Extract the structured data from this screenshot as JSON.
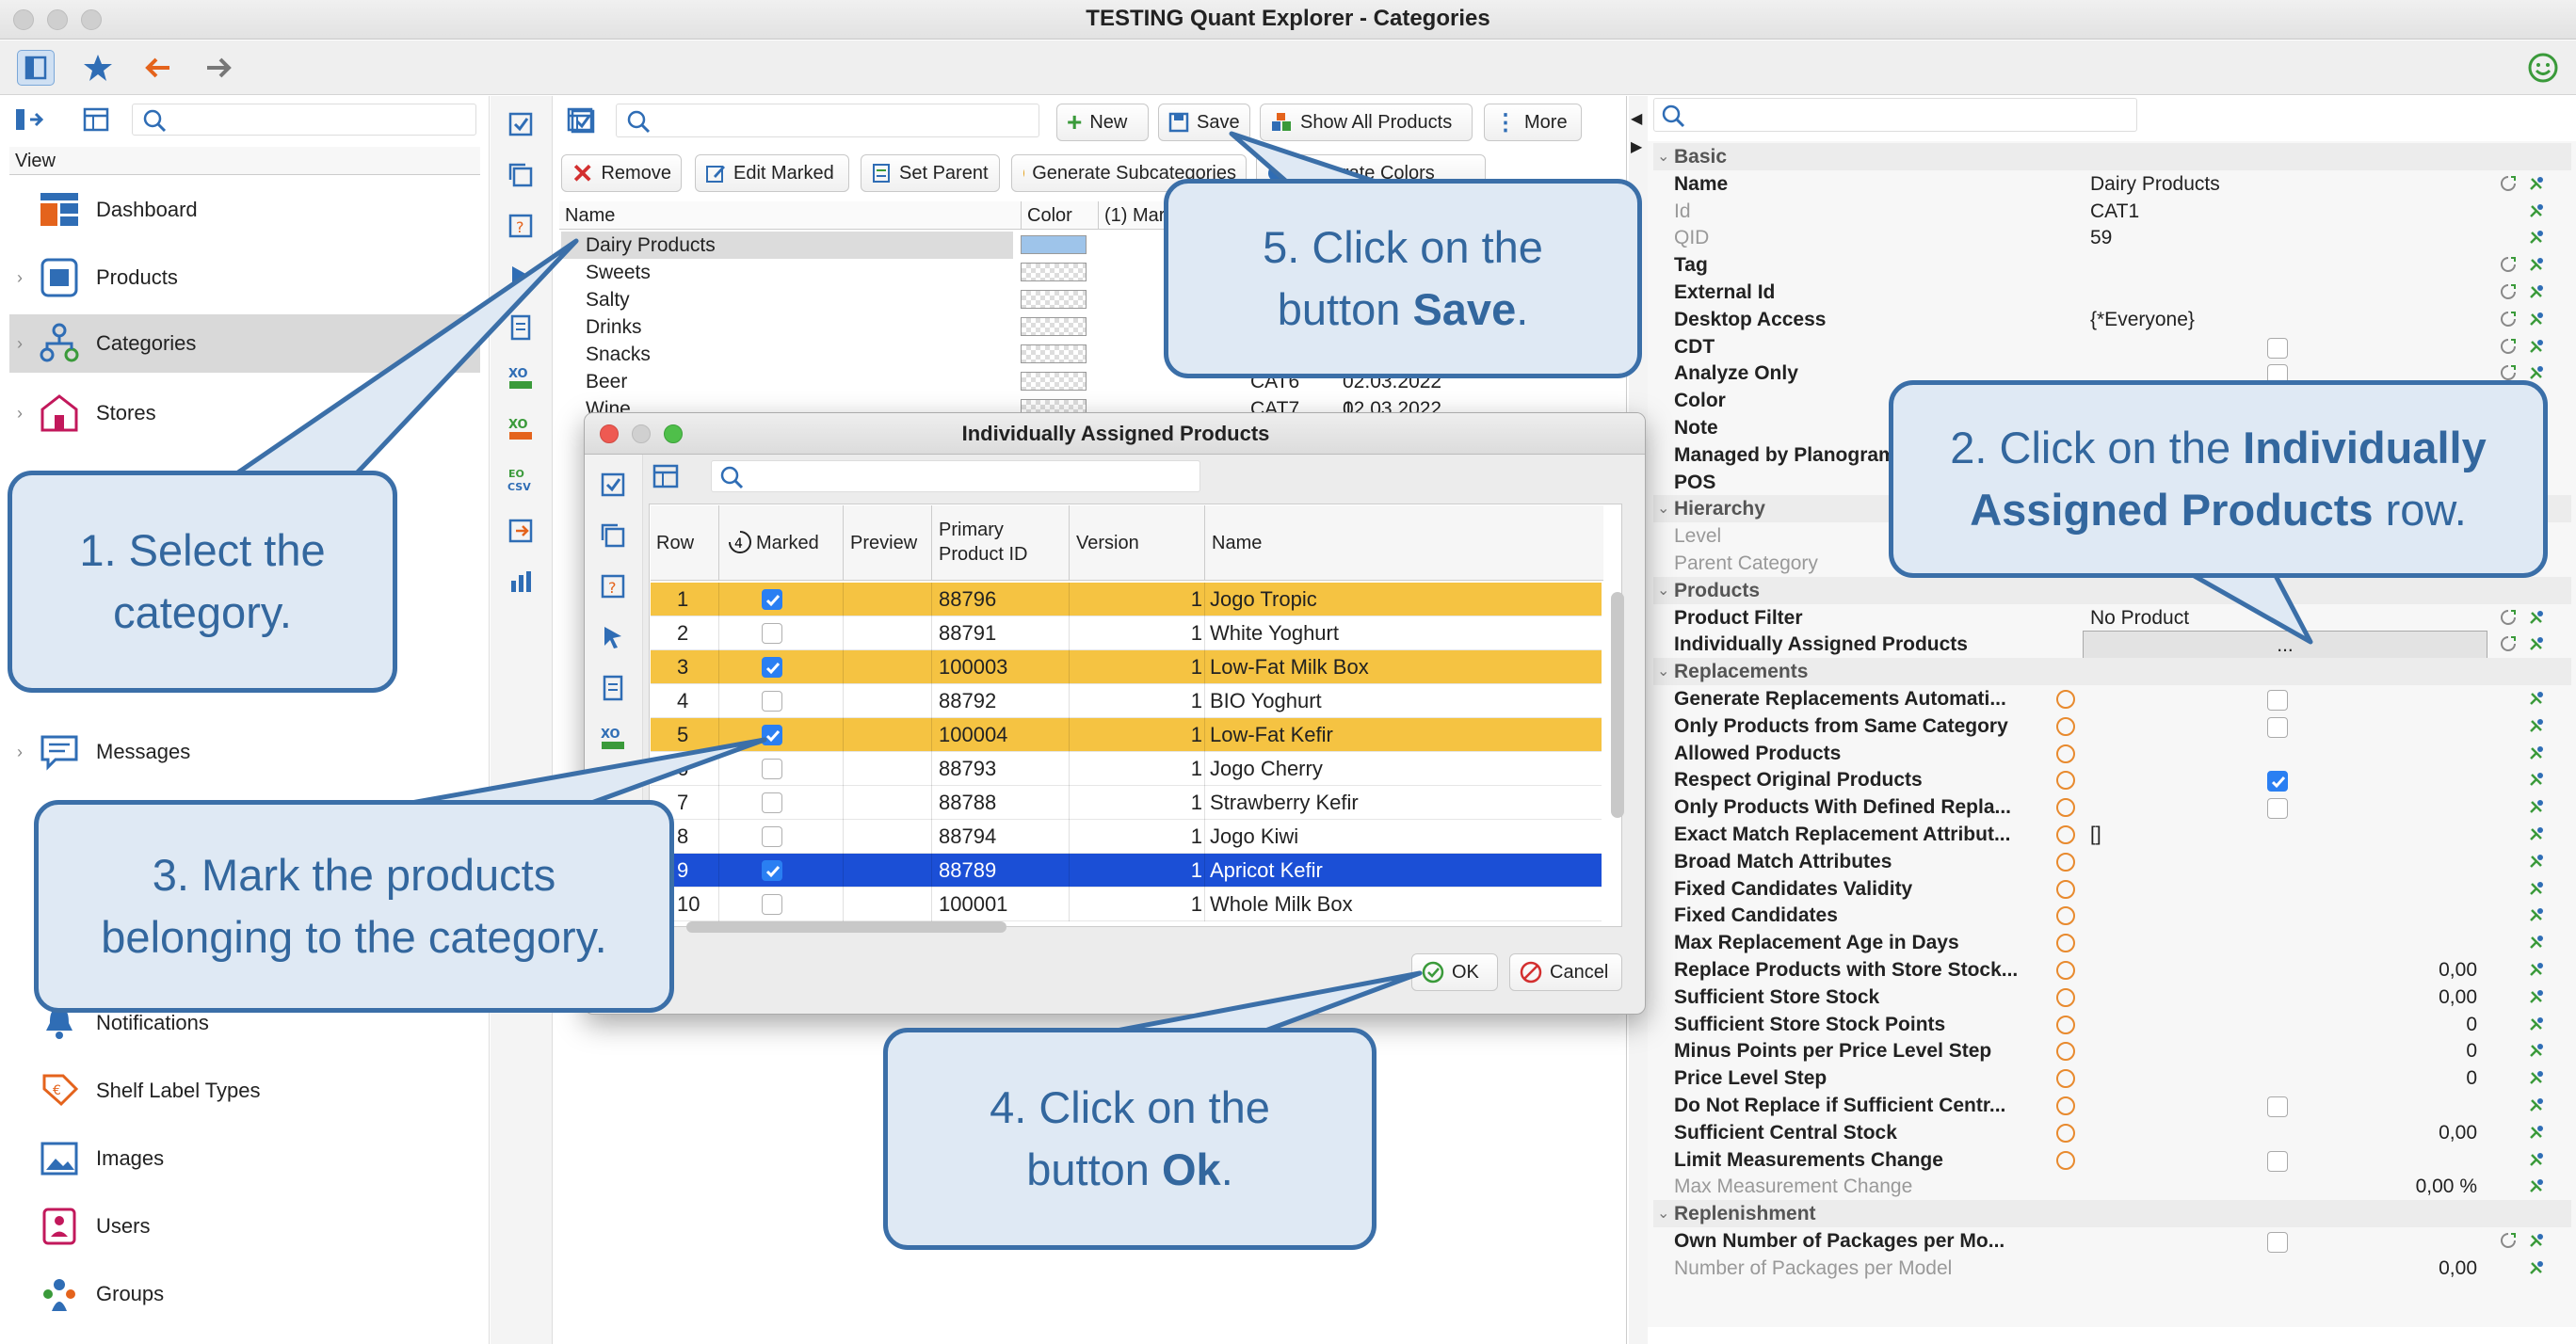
{
  "window": {
    "title": "TESTING Quant Explorer - Categories"
  },
  "nav": {
    "header": "View",
    "items": [
      {
        "label": "Dashboard",
        "icon": "dashboard-icon"
      },
      {
        "label": "Products",
        "icon": "products-icon"
      },
      {
        "label": "Categories",
        "icon": "categories-icon",
        "selected": true
      },
      {
        "label": "Stores",
        "icon": "stores-icon"
      },
      {
        "label": "Messages",
        "icon": "messages-icon"
      },
      {
        "label": "Notifications",
        "icon": "notifications-icon"
      },
      {
        "label": "Shelf Label Types",
        "icon": "shelf-label-icon"
      },
      {
        "label": "Images",
        "icon": "images-icon"
      },
      {
        "label": "Users",
        "icon": "users-icon"
      },
      {
        "label": "Groups",
        "icon": "groups-icon"
      }
    ]
  },
  "toolbar": {
    "new": "New",
    "save": "Save",
    "show_all": "Show All Products",
    "more": "More",
    "remove": "Remove",
    "edit_marked": "Edit Marked",
    "set_parent": "Set Parent",
    "generate_sub": "Generate Subcategories",
    "generate_colors": "Generate Colors"
  },
  "categories": {
    "columns": {
      "name": "Name",
      "color": "Color",
      "marked": "(1) Mar"
    },
    "rows": [
      {
        "name": "Dairy Products",
        "selected": true,
        "color": "#9ec4ea"
      },
      {
        "name": "Sweets"
      },
      {
        "name": "Salty"
      },
      {
        "name": "Drinks"
      },
      {
        "name": "Snacks"
      },
      {
        "name": "Beer",
        "id": "CAT6",
        "date": "02.03.2022 1..."
      },
      {
        "name": "Wine",
        "id": "CAT7",
        "date": "02.03.2022 1..."
      }
    ]
  },
  "dialog": {
    "title": "Individually Assigned Products",
    "columns": {
      "row": "Row",
      "marked": "Marked",
      "preview": "Preview",
      "pid_1": "Primary",
      "pid_2": "Product ID",
      "version": "Version",
      "name": "Name"
    },
    "rows": [
      {
        "row": "1",
        "marked": true,
        "pid": "88796",
        "version": "1",
        "name": "Jogo Tropic",
        "hl": "yellow"
      },
      {
        "row": "2",
        "marked": false,
        "pid": "88791",
        "version": "1",
        "name": "White Yoghurt"
      },
      {
        "row": "3",
        "marked": true,
        "pid": "100003",
        "version": "1",
        "name": "Low-Fat Milk Box",
        "hl": "yellow"
      },
      {
        "row": "4",
        "marked": false,
        "pid": "88792",
        "version": "1",
        "name": "BIO Yoghurt"
      },
      {
        "row": "5",
        "marked": true,
        "pid": "100004",
        "version": "1",
        "name": "Low-Fat Kefir",
        "hl": "yellow"
      },
      {
        "row": "6",
        "marked": false,
        "pid": "88793",
        "version": "1",
        "name": "Jogo Cherry"
      },
      {
        "row": "7",
        "marked": false,
        "pid": "88788",
        "version": "1",
        "name": "Strawberry Kefir"
      },
      {
        "row": "8",
        "marked": false,
        "pid": "88794",
        "version": "1",
        "name": "Jogo Kiwi"
      },
      {
        "row": "9",
        "marked": true,
        "pid": "88789",
        "version": "1",
        "name": "Apricot Kefir",
        "hl": "blue"
      },
      {
        "row": "10",
        "marked": false,
        "pid": "100001",
        "version": "1",
        "name": "Whole Milk Box"
      }
    ],
    "ok": "OK",
    "cancel": "Cancel"
  },
  "properties": [
    {
      "key": "Basic",
      "type": "group"
    },
    {
      "key": "Name",
      "value": "Dairy Products",
      "icons": 2
    },
    {
      "key": "Id",
      "value": "CAT1",
      "grey": true,
      "icons": 1
    },
    {
      "key": "QID",
      "value": "59",
      "grey": true,
      "icons": 1
    },
    {
      "key": "Tag",
      "value": "",
      "icons": 2
    },
    {
      "key": "External Id",
      "value": "",
      "icons": 2
    },
    {
      "key": "Desktop Access",
      "value": "{*Everyone}",
      "icons": 2
    },
    {
      "key": "CDT",
      "checkbox": false,
      "icons": 2
    },
    {
      "key": "Analyze Only",
      "checkbox": false,
      "icons": 2
    },
    {
      "key": "Color",
      "value": ""
    },
    {
      "key": "Note",
      "value": ""
    },
    {
      "key": "Managed by Planogram",
      "value": ""
    },
    {
      "key": "POS",
      "value": ""
    },
    {
      "key": "Hierarchy",
      "type": "group"
    },
    {
      "key": "Level",
      "value": "",
      "grey": true
    },
    {
      "key": "Parent Category",
      "value": "",
      "grey": true
    },
    {
      "key": "Products",
      "type": "group"
    },
    {
      "key": "Product Filter",
      "value": "No Product",
      "icons": 2
    },
    {
      "key": "Individually Assigned Products",
      "value": "...",
      "icons": 2,
      "highlight": true
    },
    {
      "key": "Replacements",
      "type": "group"
    },
    {
      "key": "Generate Replacements Automati...",
      "checkbox": false,
      "orange": true,
      "icons": 1
    },
    {
      "key": "Only Products from Same Category",
      "checkbox": false,
      "orange": true,
      "icons": 1
    },
    {
      "key": "Allowed Products",
      "value": "",
      "orange": true,
      "icons": 1
    },
    {
      "key": "Respect Original Products",
      "checkbox": true,
      "orange": true,
      "icons": 1
    },
    {
      "key": "Only Products With Defined Repla...",
      "checkbox": false,
      "orange": true,
      "icons": 1
    },
    {
      "key": "Exact Match Replacement Attribut...",
      "value": "[]",
      "orange": true,
      "icons": 1
    },
    {
      "key": "Broad Match Attributes",
      "value": "",
      "orange": true,
      "icons": 1
    },
    {
      "key": "Fixed Candidates Validity",
      "value": "",
      "orange": true,
      "icons": 1
    },
    {
      "key": "Fixed Candidates",
      "value": "",
      "orange": true,
      "icons": 1
    },
    {
      "key": "Max Replacement Age in Days",
      "value": "",
      "orange": true,
      "icons": 1
    },
    {
      "key": "Replace Products with Store Stock...",
      "num": "0,00",
      "orange": true,
      "icons": 1
    },
    {
      "key": "Sufficient Store Stock",
      "num": "0,00",
      "orange": true,
      "icons": 1
    },
    {
      "key": "Sufficient Store Stock Points",
      "num": "0",
      "orange": true,
      "icons": 1
    },
    {
      "key": "Minus Points per Price Level Step",
      "num": "0",
      "orange": true,
      "icons": 1
    },
    {
      "key": "Price Level Step",
      "num": "0",
      "orange": true,
      "icons": 1
    },
    {
      "key": "Do Not Replace if Sufficient Centr...",
      "checkbox": false,
      "orange": true,
      "icons": 1
    },
    {
      "key": "Sufficient Central Stock",
      "num": "0,00",
      "orange": true,
      "icons": 1
    },
    {
      "key": "Limit Measurements Change",
      "checkbox": false,
      "orange": true,
      "icons": 1
    },
    {
      "key": "Max Measurement Change",
      "num": "0,00 %",
      "grey": true,
      "icons": 1
    },
    {
      "key": "Replenishment",
      "type": "group"
    },
    {
      "key": "Own Number of Packages per Mo...",
      "checkbox": false,
      "icons": 2
    },
    {
      "key": "Number of Packages per Model",
      "num": "0,00",
      "grey": true,
      "icons": 1
    }
  ],
  "callouts": {
    "c1": {
      "text": "1. Select the category."
    },
    "c2": {
      "pre": "2. Click on the ",
      "bold": "Individually Assigned Products",
      "post": " row."
    },
    "c3": {
      "text": "3. Mark the products belonging to the category."
    },
    "c4": {
      "pre": "4. Click on the button ",
      "bold": "Ok",
      "post": "."
    },
    "c5": {
      "pre": "5. Click on the button ",
      "bold": "Save",
      "post": "."
    }
  },
  "colors": {
    "accent": "#2a7ff2",
    "callout_border": "#3b6fa8",
    "callout_fill": "#dfe9f4",
    "highlight_yellow": "#f5c342",
    "highlight_blue": "#1b4fd6"
  }
}
